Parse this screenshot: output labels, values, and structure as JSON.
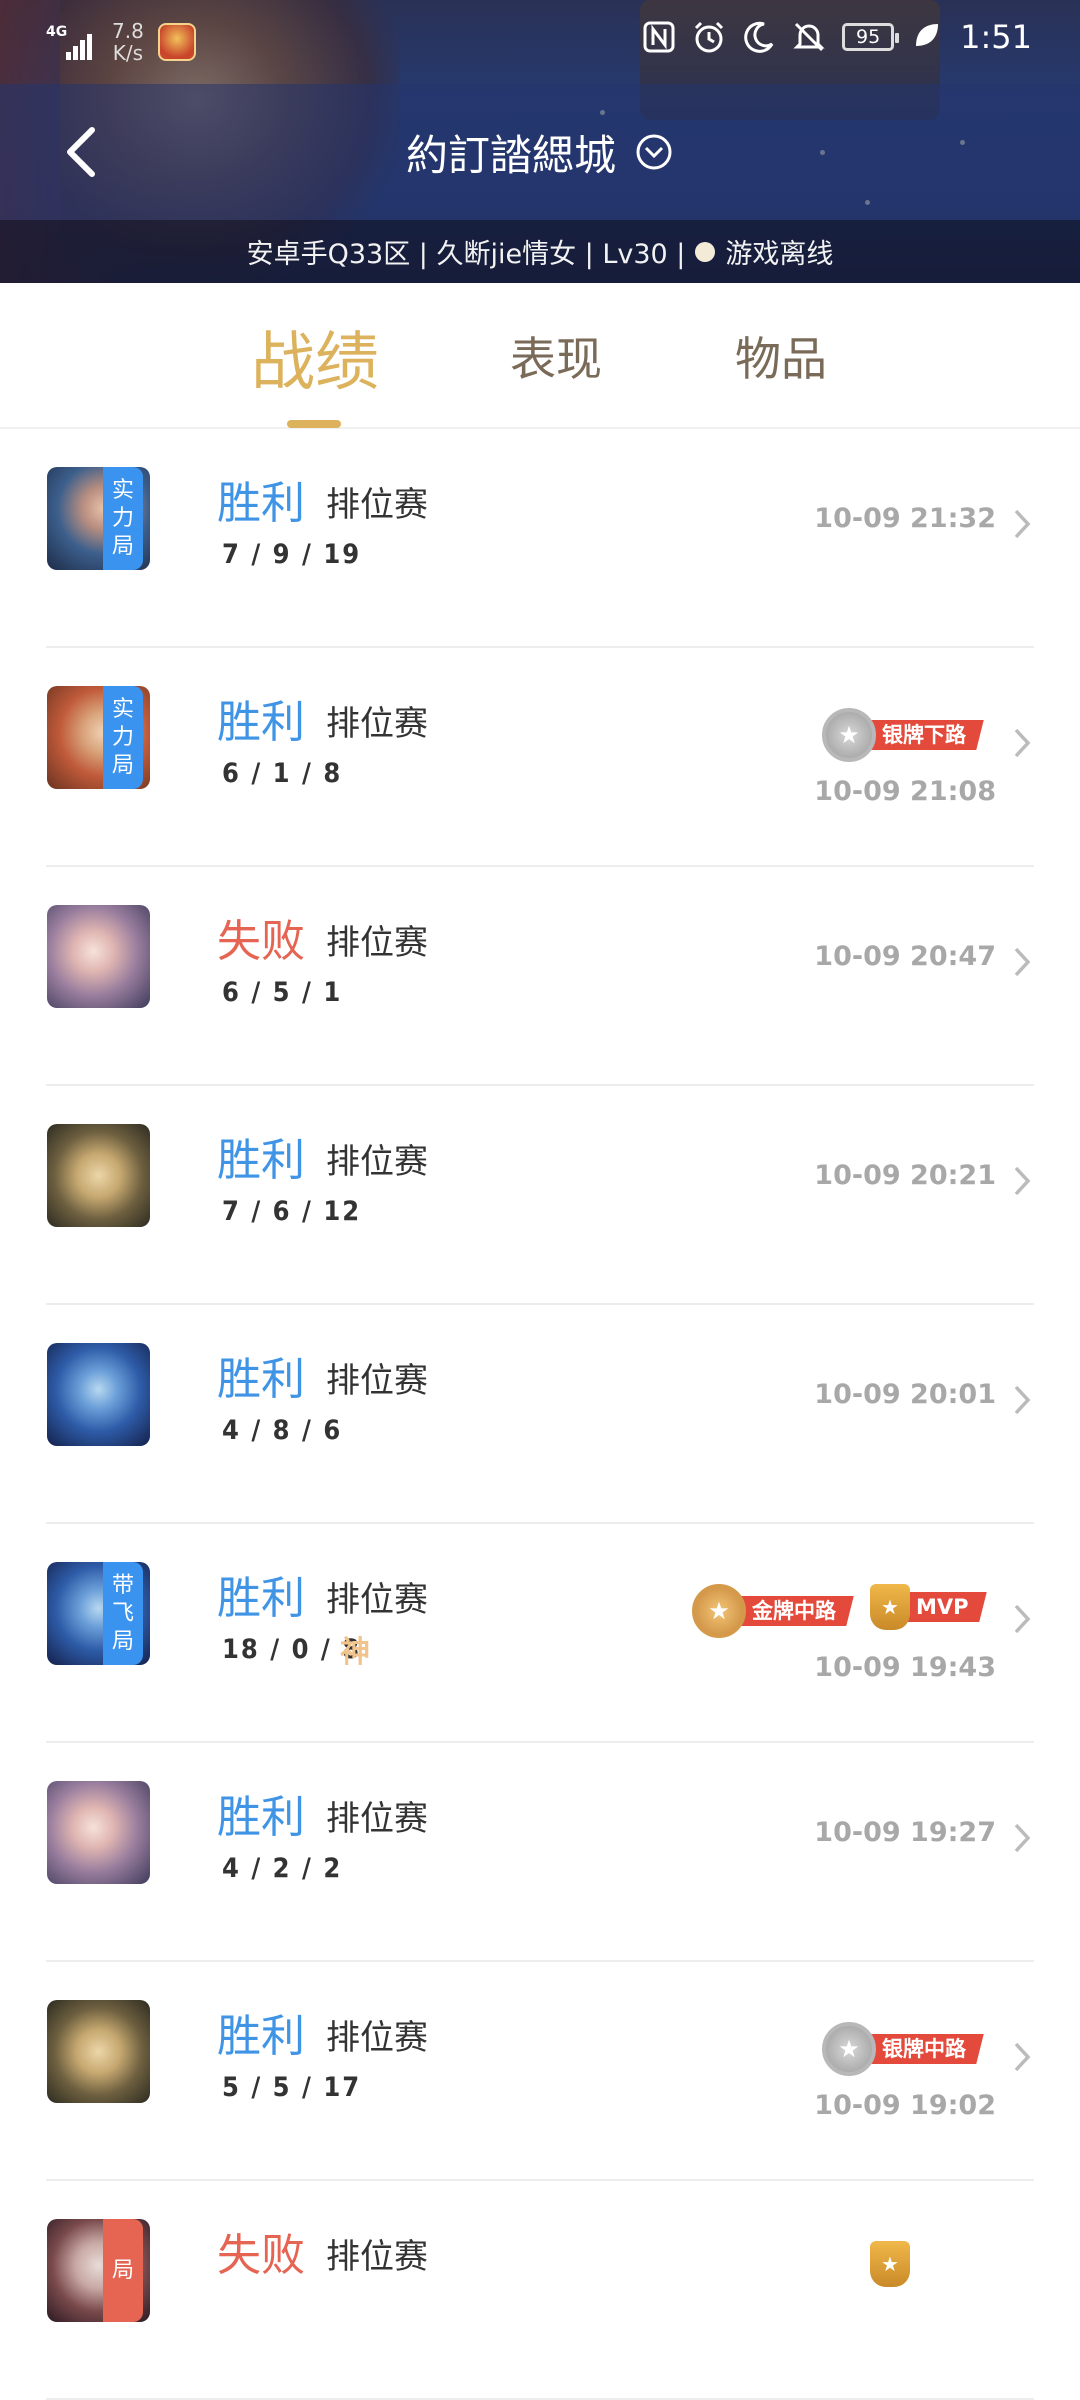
{
  "status_bar": {
    "network": "4G",
    "speed_value": "7.8",
    "speed_unit": "K/s",
    "battery": "95",
    "time": "1:51"
  },
  "header": {
    "title": "約訂誻緦城",
    "server_info": "安卓手Q33区 | 久断jie情女 | Lv30 |",
    "online_status": "游戏离线"
  },
  "tabs": [
    {
      "label": "战绩",
      "active": true
    },
    {
      "label": "表现",
      "active": false
    },
    {
      "label": "物品",
      "active": false
    }
  ],
  "matches": [
    {
      "result": "胜利",
      "win": true,
      "mode": "排位赛",
      "kda": "7 / 9 / 19",
      "time": "10-09 21:32",
      "badge": [
        "实",
        "力",
        "局"
      ],
      "medals": []
    },
    {
      "result": "胜利",
      "win": true,
      "mode": "排位赛",
      "kda": "6 / 1 / 8",
      "time": "10-09 21:08",
      "badge": [
        "实",
        "力",
        "局"
      ],
      "medals": [
        {
          "type": "silver",
          "label": "银牌下路"
        }
      ]
    },
    {
      "result": "失败",
      "win": false,
      "mode": "排位赛",
      "kda": "6 / 5 / 1",
      "time": "10-09 20:47",
      "badge": [],
      "medals": []
    },
    {
      "result": "胜利",
      "win": true,
      "mode": "排位赛",
      "kda": "7 / 6 / 12",
      "time": "10-09 20:21",
      "badge": [],
      "medals": []
    },
    {
      "result": "胜利",
      "win": true,
      "mode": "排位赛",
      "kda": "4 / 8 / 6",
      "time": "10-09 20:01",
      "badge": [],
      "medals": []
    },
    {
      "result": "胜利",
      "win": true,
      "mode": "排位赛",
      "kda": "18 / 0 / 8",
      "god": "神",
      "time": "10-09 19:43",
      "badge": [
        "带",
        "飞",
        "局"
      ],
      "medals": [
        {
          "type": "gold",
          "label": "金牌中路"
        },
        {
          "type": "mvp",
          "label": "MVP"
        }
      ]
    },
    {
      "result": "胜利",
      "win": true,
      "mode": "排位赛",
      "kda": "4 / 2 / 2",
      "time": "10-09 19:27",
      "badge": [],
      "medals": []
    },
    {
      "result": "胜利",
      "win": true,
      "mode": "排位赛",
      "kda": "5 / 5 / 17",
      "time": "10-09 19:02",
      "badge": [],
      "medals": [
        {
          "type": "silver",
          "label": "银牌中路"
        }
      ]
    },
    {
      "result": "失败",
      "win": false,
      "mode": "排位赛",
      "kda": "",
      "time": "",
      "badge": [
        "局"
      ],
      "medals": []
    }
  ],
  "colors": {
    "win": "#3f94e6",
    "lose": "#e56452",
    "accent": "#dcb25c",
    "badge": "#3a93ef",
    "ribbon": "#e44a3c"
  }
}
